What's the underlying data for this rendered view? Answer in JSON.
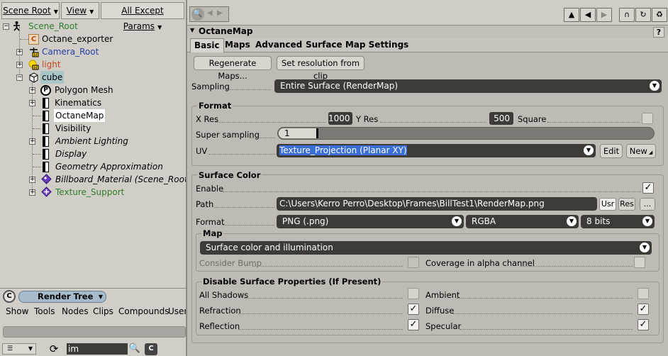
{
  "explorer": {
    "scope_label": "Scene Root",
    "view_label": "View",
    "filter_label": "All Except Params",
    "tree": [
      {
        "label": "Scene_Root",
        "color": "#2f7d2f"
      },
      {
        "label": "Octane_exporter",
        "color": "#000000"
      },
      {
        "label": "Camera_Root",
        "color": "#2a3ea8"
      },
      {
        "label": "light",
        "color": "#c0461a"
      },
      {
        "label": "cube",
        "color": "#000000"
      },
      {
        "label": "Polygon Mesh",
        "color": "#000000"
      },
      {
        "label": "Kinematics",
        "color": "#000000"
      },
      {
        "label": "OctaneMap",
        "color": "#000000"
      },
      {
        "label": "Visibility",
        "color": "#000000"
      },
      {
        "label": "Ambient Lighting",
        "color": "#000000"
      },
      {
        "label": "Display",
        "color": "#000000"
      },
      {
        "label": "Geometry Approximation",
        "color": "#000000"
      },
      {
        "label": "Billboard_Material (Scene_Root)",
        "color": "#000000"
      },
      {
        "label": "Texture_Support",
        "color": "#2f7d2f"
      }
    ]
  },
  "render_tree": {
    "title": "Render Tree",
    "menu": [
      "Show",
      "Tools",
      "Nodes",
      "Clips",
      "Compounds",
      "User"
    ],
    "search_value": "im"
  },
  "ppg": {
    "title": "OctaneMap",
    "help": "?",
    "tabs": [
      "Basic",
      "Maps",
      "Advanced",
      "Surface Map Settings"
    ],
    "regenerate_label": "Regenerate Maps...",
    "set_resolution_label": "Set resolution from clip",
    "sampling_label": "Sampling",
    "sampling_value": "Entire Surface (RenderMap)",
    "format_group": "Format",
    "xres_label": "X Res",
    "xres_value": "1000",
    "yres_label": "Y Res",
    "yres_value": "500",
    "square_label": "Square",
    "supersampling_label": "Super sampling",
    "supersampling_value": "1",
    "uv_label": "UV",
    "uv_value": "Texture_Projection (Planar XY)",
    "edit_label": "Edit",
    "new_label": "New",
    "surface_color_group": "Surface Color",
    "enable_label": "Enable",
    "path_label": "Path",
    "path_value": "C:\\Users\\Kerro Perro\\Desktop\\Frames\\BillTest1\\RenderMap.png",
    "usr_label": "Usr",
    "res_label": "Res",
    "browse_label": "...",
    "format_label": "Format",
    "format_value": "PNG (.png)",
    "channels_value": "RGBA",
    "bits_value": "8 bits",
    "map_group": "Map",
    "map_value": "Surface color and illumination",
    "consider_bump_label": "Consider Bump",
    "coverage_label": "Coverage in alpha channel",
    "disable_group": "Disable Surface Properties (If Present)",
    "all_shadows_label": "All Shadows",
    "ambient_label": "Ambient",
    "refraction_label": "Refraction",
    "diffuse_label": "Diffuse",
    "reflection_label": "Reflection",
    "specular_label": "Specular"
  }
}
